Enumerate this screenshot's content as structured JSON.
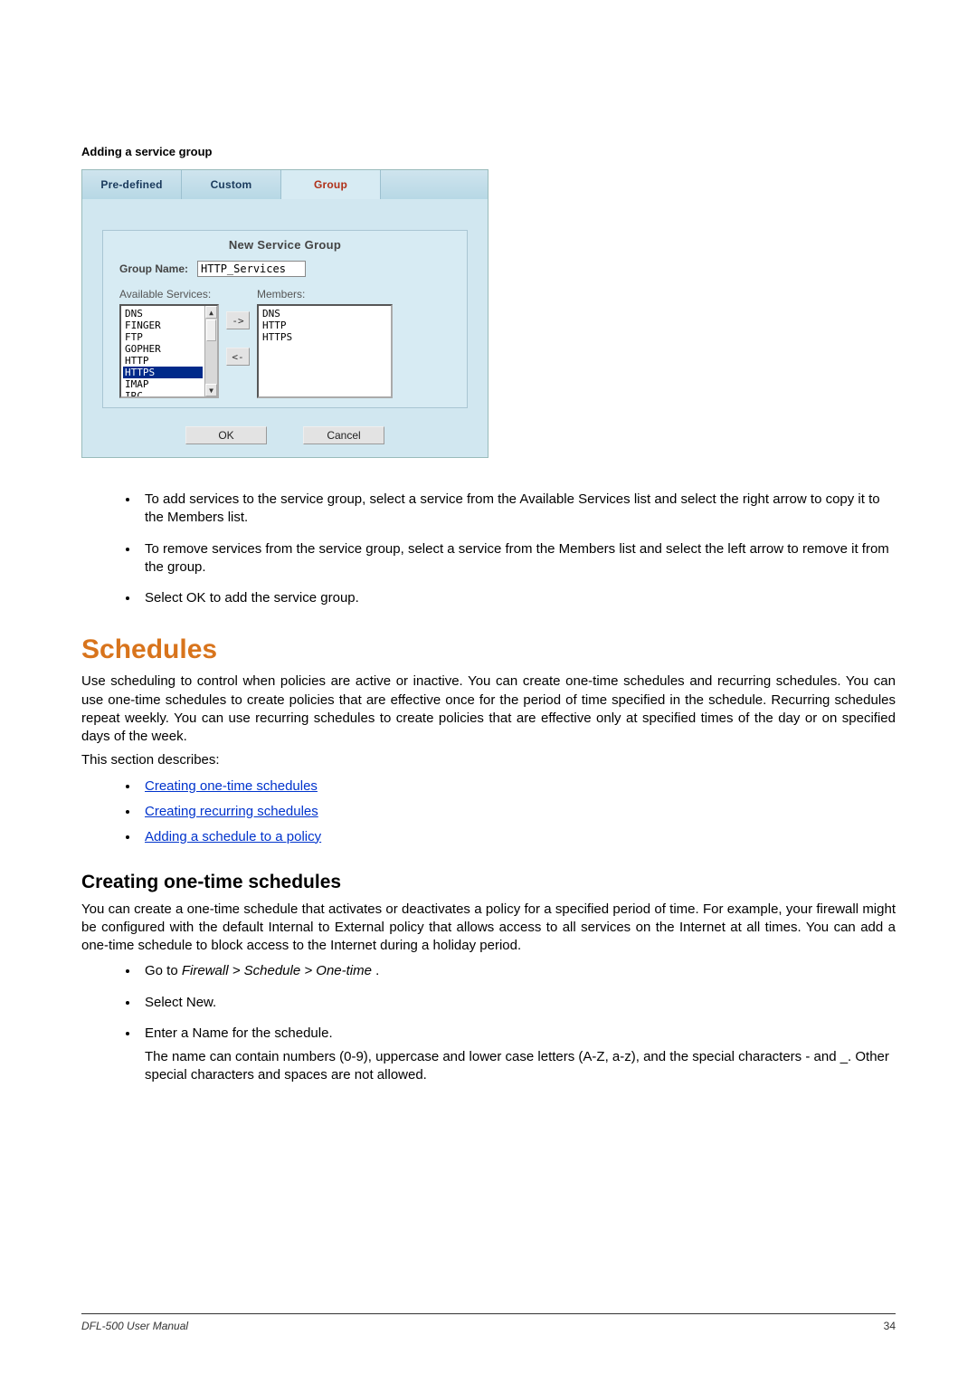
{
  "caption": "Adding a service group",
  "figure": {
    "tabs": {
      "predefined": "Pre-defined",
      "custom": "Custom",
      "group": "Group"
    },
    "panel_title": "New Service Group",
    "group_name_label": "Group Name:",
    "group_name_value": "HTTP_Services",
    "available_label": "Available Services:",
    "members_label": "Members:",
    "available": [
      "DNS",
      "FINGER",
      "FTP",
      "GOPHER",
      "HTTP",
      "HTTPS",
      "IMAP",
      "IRC"
    ],
    "available_selected": "HTTPS",
    "members": [
      "DNS",
      "HTTP",
      "HTTPS"
    ],
    "btn_right": "->",
    "btn_left": "<-",
    "btn_ok": "OK",
    "btn_cancel": "Cancel",
    "scroll_up": "▲",
    "scroll_down": "▼"
  },
  "bullets_top": [
    "To add services to the service group, select a service from the Available Services list and select the right arrow to copy it to the Members list.",
    "To remove services from the service group, select a service from the Members list and select the left arrow to remove it from the group.",
    "Select OK to add the service group."
  ],
  "heading_schedules": "Schedules",
  "para_schedules": "Use scheduling to control when policies are active or inactive. You can create one-time schedules and recurring schedules. You can use one-time schedules to create policies that are effective once for the period of time specified in the schedule. Recurring schedules repeat weekly. You can use recurring schedules to create policies that are effective only at specified times of the day or on specified days of the week.",
  "para_describes": "This section describes:",
  "links": [
    "Creating one-time schedules",
    "Creating recurring schedules",
    "Adding a schedule to a policy"
  ],
  "subheading": "Creating one-time schedules",
  "para_sub": "You can create a one-time schedule that activates or deactivates a policy for a specified period of time. For example, your firewall might be configured with the default Internal to External policy that allows access to all services on the Internet at all times. You can add a one-time schedule to block access to the Internet during a holiday period.",
  "steps": {
    "s1_prefix": "Go to ",
    "s1_path": "Firewall > Schedule > One-time",
    "s1_suffix": " .",
    "s2": "Select New.",
    "s3": "Enter a Name for the schedule.",
    "s3_sub": "The name can contain numbers (0-9), uppercase and lower case letters (A-Z, a-z), and the special characters - and _. Other special characters and spaces are not allowed."
  },
  "footer_left": "DFL-500 User Manual",
  "footer_right": "34"
}
